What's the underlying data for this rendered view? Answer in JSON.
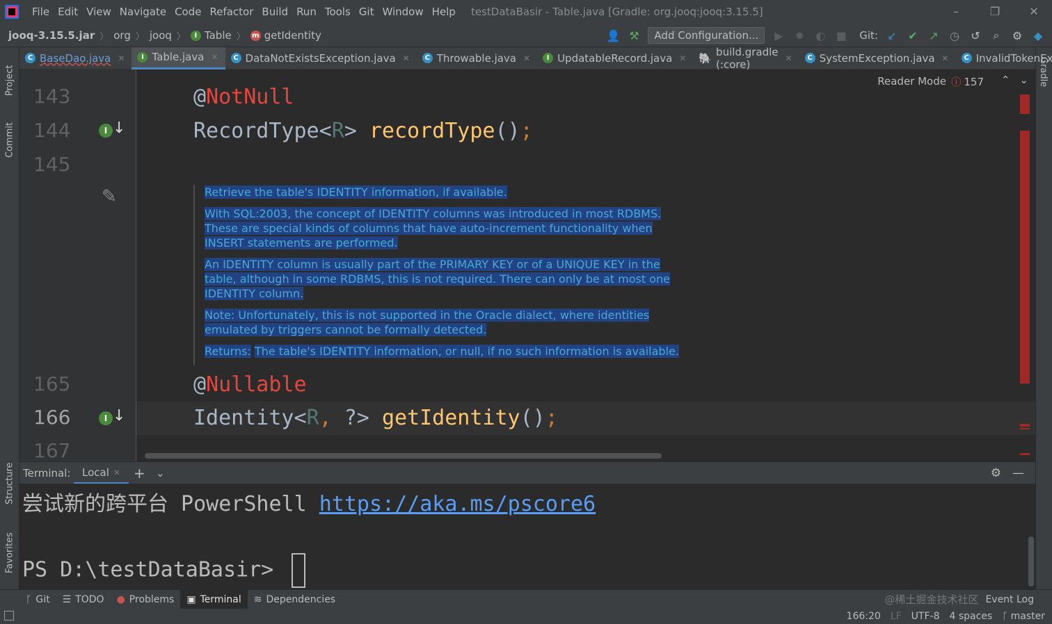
{
  "window": {
    "menu": [
      "File",
      "Edit",
      "View",
      "Navigate",
      "Code",
      "Refactor",
      "Build",
      "Run",
      "Tools",
      "Git",
      "Window",
      "Help"
    ],
    "title": "testDataBasir - Table.java [Gradle: org.jooq:jooq:3.15.5]",
    "minimize": "–",
    "restore": "❐",
    "close": "✕"
  },
  "breadcrumbs": {
    "jar": "jooq-3.15.5.jar",
    "pkg1": "org",
    "pkg2": "jooq",
    "class": "Table",
    "method": "getIdentity"
  },
  "toolbar": {
    "add_config": "Add Configuration...",
    "git_label": "Git:"
  },
  "tabs": [
    {
      "label": "BaseDao.java",
      "icon": "C"
    },
    {
      "label": "Table.java",
      "icon": "I"
    },
    {
      "label": "DataNotExistsException.java",
      "icon": "C"
    },
    {
      "label": "Throwable.java",
      "icon": "C"
    },
    {
      "label": "UpdatableRecord.java",
      "icon": "I"
    },
    {
      "label": "build.gradle (:core)",
      "icon": "gradle"
    },
    {
      "label": "SystemException.java",
      "icon": "C"
    },
    {
      "label": "InvalidTokenExce",
      "icon": "C"
    }
  ],
  "side": {
    "project": "Project",
    "commit": "Commit",
    "structure": "Structure",
    "favorites": "Favorites",
    "gradle": "Gradle"
  },
  "editor": {
    "reader_mode": "Reader Mode",
    "error_count": "157",
    "line_numbers": [
      "143",
      "144",
      "145",
      "165",
      "166",
      "167"
    ],
    "line143": {
      "at": "@",
      "name": "NotNull"
    },
    "line144": {
      "type": "RecordType<",
      "gen": "R",
      "close": "> ",
      "fn": "recordType",
      "paren": "()",
      "semi": ";"
    },
    "line165": {
      "at": "@",
      "name": "Nullable"
    },
    "line166": {
      "type": "Identity<",
      "gen": "R",
      "comma": ", ",
      "rest": "?> ",
      "fn": "getIdentity",
      "paren": "()",
      "semi": ";"
    },
    "doc": {
      "p1": "Retrieve the table's IDENTITY information, if available.",
      "p2": "With SQL:2003, the concept of IDENTITY columns was introduced in most RDBMS. These are special kinds of columns that have auto-increment functionality when INSERT statements are performed.",
      "p3": "An IDENTITY column is usually part of the PRIMARY KEY or of a UNIQUE KEY in the table, although in some RDBMS, this is not required. There can only be at most one IDENTITY column.",
      "p4": "Note: Unfortunately, this is not supported in the Oracle dialect, where identities emulated by triggers cannot be formally detected.",
      "p5_label": "Returns:",
      "p5": "The table's IDENTITY information, or null, if no such information is available."
    }
  },
  "terminal": {
    "title": "Terminal:",
    "tab": "Local",
    "line1_text": "尝试新的跨平台 PowerShell ",
    "line1_link": "https://aka.ms/pscore6",
    "prompt": "PS D:\\testDataBasir> "
  },
  "bottom_tools": [
    "Git",
    "TODO",
    "Problems",
    "Terminal",
    "Dependencies"
  ],
  "watermark": "@稀土掘金技术社区",
  "event_log": "Event Log",
  "status": {
    "position": "166:20",
    "line_sep": "LF",
    "encoding": "UTF-8",
    "indent": "4 spaces",
    "branch": "master"
  },
  "colors": {
    "background": "#2b2b2b",
    "panel": "#3c3f41",
    "selection": "#214283",
    "doc_text": "#4aa8d8",
    "annotation": "#e8453c",
    "method": "#ffc66d",
    "accent": "#4a88c7"
  }
}
